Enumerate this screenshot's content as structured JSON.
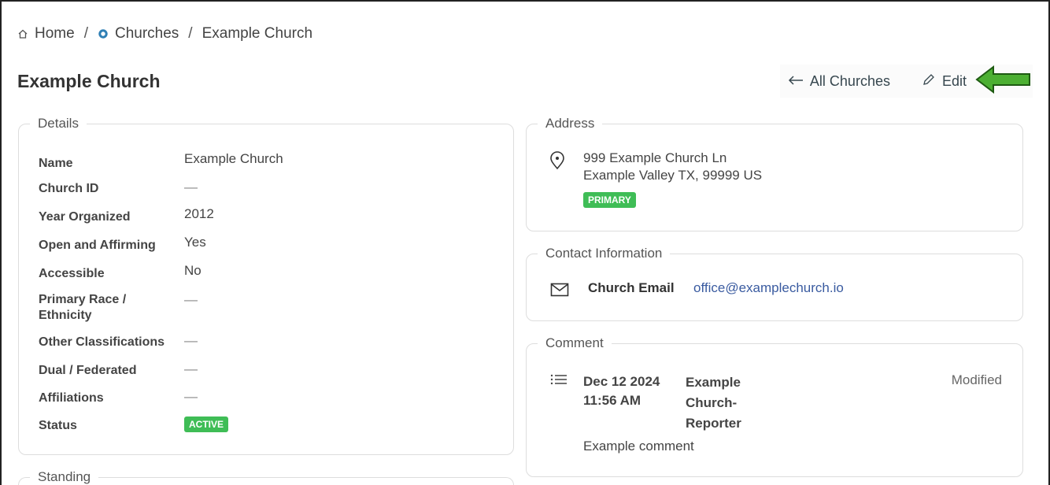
{
  "breadcrumb": {
    "home": "Home",
    "churches": "Churches",
    "current": "Example Church",
    "separator": "/"
  },
  "page": {
    "title": "Example Church"
  },
  "actions": {
    "all_churches": "All Churches",
    "edit": "Edit"
  },
  "details": {
    "legend": "Details",
    "rows": [
      {
        "label": "Name",
        "value": "Example Church"
      },
      {
        "label": "Church ID",
        "value": "—"
      },
      {
        "label": "Year Organized",
        "value": "2012"
      },
      {
        "label": "Open and Affirming",
        "value": "Yes"
      },
      {
        "label": "Accessible",
        "value": "No"
      },
      {
        "label": "Primary Race / Ethnicity",
        "value": "—"
      },
      {
        "label": "Other Classifications",
        "value": "—"
      },
      {
        "label": "Dual / Federated",
        "value": "—"
      },
      {
        "label": "Affiliations",
        "value": "—"
      },
      {
        "label": "Status",
        "value": "ACTIVE"
      }
    ]
  },
  "standing": {
    "legend": "Standing"
  },
  "address": {
    "legend": "Address",
    "line1": "999 Example Church Ln",
    "line2": "Example Valley TX, 99999 US",
    "badge": "PRIMARY"
  },
  "contact": {
    "legend": "Contact Information",
    "label": "Church Email",
    "value": "office@examplechurch.io"
  },
  "comment": {
    "legend": "Comment",
    "date": "Dec 12 2024",
    "time": "11:56 AM",
    "author_line1": "Example",
    "author_line2": "Church-",
    "author_line3": "Reporter",
    "status": "Modified",
    "text": "Example comment"
  },
  "colors": {
    "badge_green": "#3fbd56",
    "link_blue": "#3a5ba0",
    "annotation_arrow": "#4caf32"
  }
}
